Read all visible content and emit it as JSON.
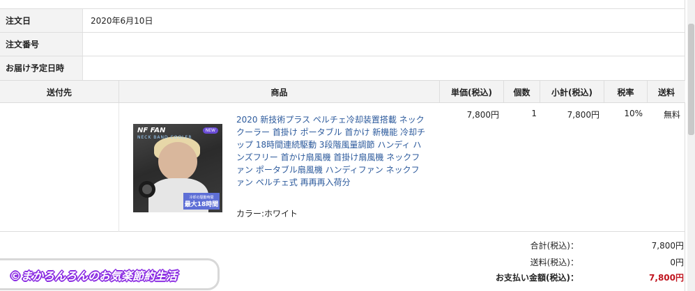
{
  "info": {
    "order_date_label": "注文日",
    "order_date_value": "2020年6月10日",
    "order_number_label": "注文番号",
    "order_number_value": "",
    "delivery_label": "お届け予定日時",
    "delivery_value": ""
  },
  "table": {
    "headers": [
      "送付先",
      "商品",
      "単価(税込)",
      "個数",
      "小計(税込)",
      "税率",
      "送料"
    ],
    "row": {
      "destination": "",
      "product_name": "2020 新技術プラス ペルチェ冷却装置搭載 ネッククーラー 首掛け ポータブル 首かけ 新機能 冷却チップ 18時間連続駆動 3段階風量調節 ハンディ ハンズフリー 首かけ扇風機 首掛け扇風機 ネックファン ポータブル扇風機 ハンディファン ネックファン ペルチェ式 再再再入荷分",
      "product_option": "カラー:ホワイト",
      "unit_price": "7,800円",
      "quantity": "1",
      "subtotal": "7,800円",
      "tax_rate": "10%",
      "shipping": "無料"
    }
  },
  "product_image": {
    "brand": "NF FAN",
    "sub": "NECK BAND COOLER",
    "badge": "NEW",
    "bubble_line1": "冷却の駆動時間",
    "bubble_line2": "最大18時間"
  },
  "summary": {
    "total_label": "合計(税込)：",
    "total_value": "7,800円",
    "shipping_label": "送料(税込)：",
    "shipping_value": "0円",
    "payment_label": "お支払い金額(税込)：",
    "payment_value": "7,800円"
  },
  "watermark": "©まかろんろんのお気楽節約生活",
  "colors": {
    "link": "#2c5a9c",
    "price_red": "#c0141e",
    "header_bg": "#f3f3f3",
    "watermark_outline": "#8a2be2"
  }
}
